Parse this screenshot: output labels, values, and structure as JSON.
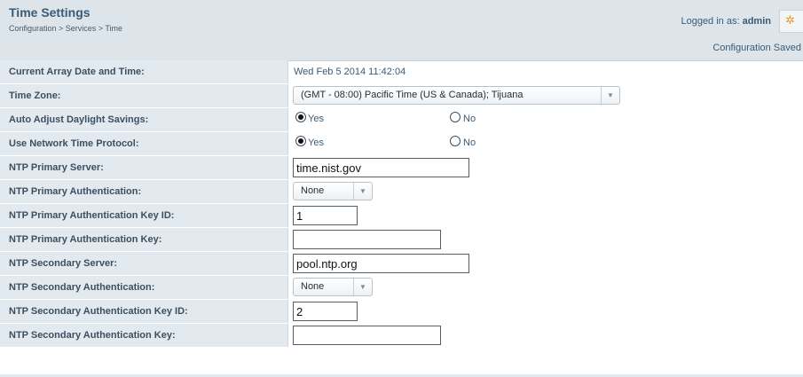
{
  "header": {
    "title": "Time Settings",
    "breadcrumb": "Configuration > Services > Time",
    "logged_in_prefix": "Logged in as:",
    "user": "admin",
    "status": "Configuration Saved"
  },
  "fields": {
    "current_time": {
      "label": "Current Array Date and Time:",
      "value": "Wed Feb 5 2014 11:42:04"
    },
    "time_zone": {
      "label": "Time Zone:",
      "value": "(GMT - 08:00) Pacific Time (US & Canada); Tijuana"
    },
    "auto_dst": {
      "label": "Auto Adjust Daylight Savings:",
      "yes": "Yes",
      "no": "No",
      "selected": "Yes"
    },
    "use_ntp": {
      "label": "Use Network Time Protocol:",
      "yes": "Yes",
      "no": "No",
      "selected": "Yes"
    },
    "ntp_primary_server": {
      "label": "NTP Primary Server:",
      "value": "time.nist.gov"
    },
    "ntp_primary_auth": {
      "label": "NTP Primary Authentication:",
      "value": "None"
    },
    "ntp_primary_key_id": {
      "label": "NTP Primary Authentication Key ID:",
      "value": "1"
    },
    "ntp_primary_key": {
      "label": "NTP Primary Authentication Key:",
      "value": ""
    },
    "ntp_secondary_server": {
      "label": "NTP Secondary Server:",
      "value": "pool.ntp.org"
    },
    "ntp_secondary_auth": {
      "label": "NTP Secondary Authentication:",
      "value": "None"
    },
    "ntp_secondary_key_id": {
      "label": "NTP Secondary Authentication Key ID:",
      "value": "2"
    },
    "ntp_secondary_key": {
      "label": "NTP Secondary Authentication Key:",
      "value": ""
    }
  },
  "icons": {
    "settings": "gear-icon",
    "dropdown": "chevron-down-icon"
  }
}
